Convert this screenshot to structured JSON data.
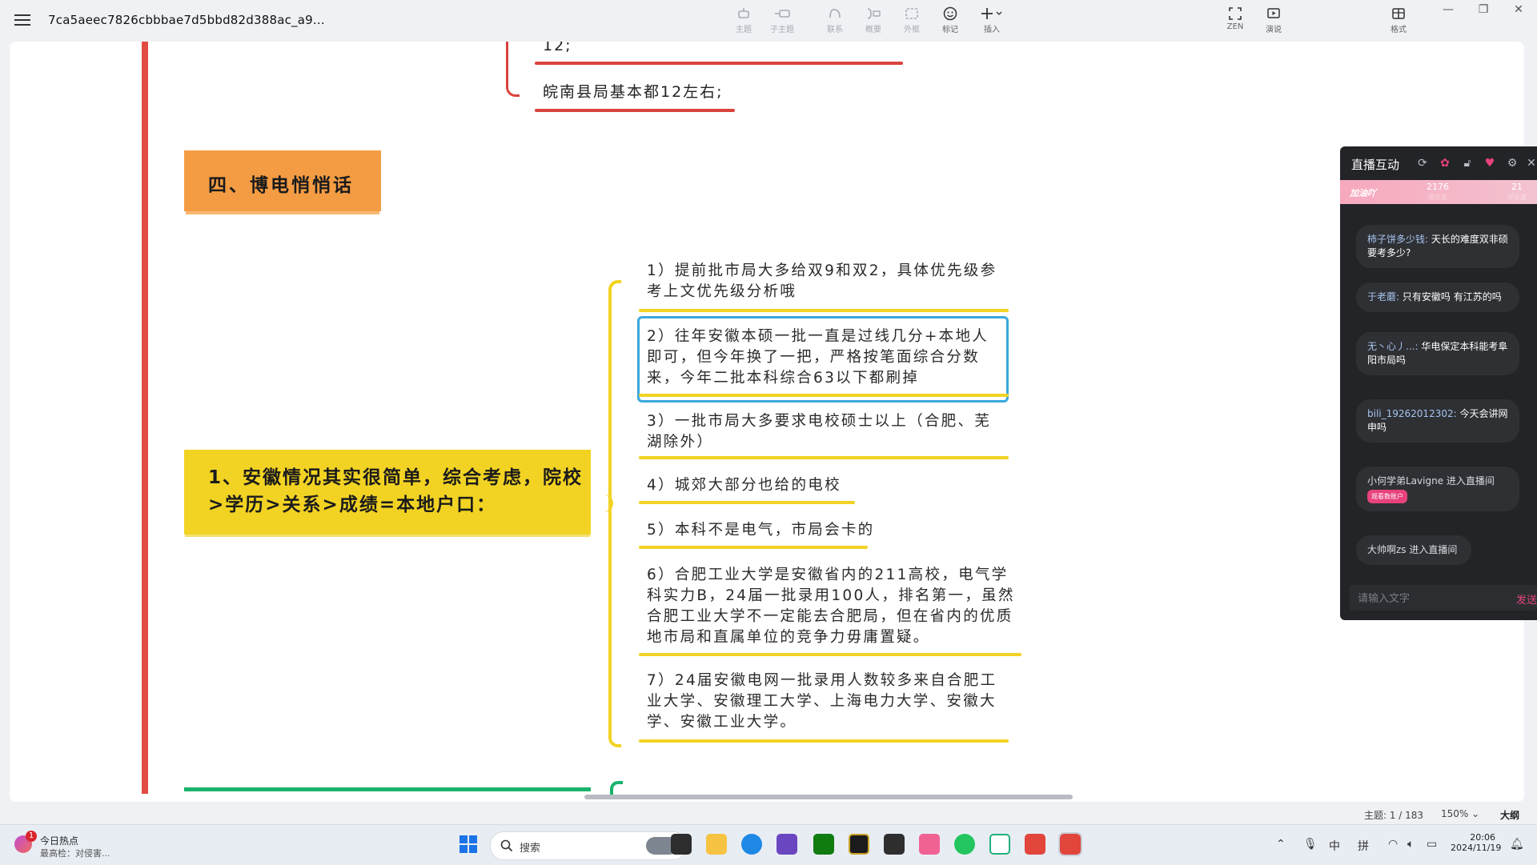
{
  "window": {
    "title": "7ca5aeec7826cbbbae7d5bbd82d388ac_a9...",
    "controls": [
      "—",
      "❐",
      "✕"
    ]
  },
  "toolbar": {
    "items": [
      {
        "label": "主题",
        "icon": "topic-icon",
        "enabled": false
      },
      {
        "label": "子主题",
        "icon": "subtopic-icon",
        "enabled": false
      },
      {
        "label": "联系",
        "icon": "relationship-icon",
        "enabled": false
      },
      {
        "label": "概要",
        "icon": "summary-icon",
        "enabled": false
      },
      {
        "label": "外框",
        "icon": "boundary-icon",
        "enabled": false
      },
      {
        "label": "标记",
        "icon": "marker-icon",
        "enabled": true
      },
      {
        "label": "插入",
        "icon": "insert-icon",
        "enabled": true
      },
      {
        "label": "ZEN",
        "icon": "zen-icon",
        "enabled": true
      },
      {
        "label": "演说",
        "icon": "pitch-icon",
        "enabled": true
      },
      {
        "label": "格式",
        "icon": "format-icon",
        "enabled": true
      }
    ]
  },
  "mindmap": {
    "top_fragment": "12;",
    "top_node": "皖南县局基本都12左右;",
    "section_title": "四、博电悄悄话",
    "main_node": "1、安徽情况其实很简单，综合考虑，院校>学历>关系>成绩=本地户口：",
    "items": [
      "1）提前批市局大多给双9和双2，具体优先级参考上文优先级分析哦",
      "2）往年安徽本硕一批一直是过线几分+本地人即可，但今年换了一把，严格按笔面综合分数来，今年二批本科综合63以下都刷掉",
      "3）一批市局大多要求电校硕士以上（合肥、芜湖除外）",
      "4）城郊大部分也给的电校",
      "5）本科不是电气，市局会卡的",
      "6）合肥工业大学是安徽省内的211高校，电气学科实力B，24届一批录用100人，排名第一，虽然合肥工业大学不一定能去合肥局，但在省内的优质地市局和直属单位的竞争力毋庸置疑。",
      "7）24届安徽电网一批录用人数较多来自合肥工业大学、安徽理工大学、上海电力大学、安徽大学、安徽工业大学。"
    ],
    "colors": {
      "spine": "#e14b42",
      "section": "#f49c43",
      "main": "#f2d323",
      "next": "#19b36b",
      "selection": "#3aa8dd"
    }
  },
  "live_panel": {
    "title": "直播互动",
    "tag": "加油吖",
    "stats": [
      {
        "value": "2176",
        "label": "曝光量"
      },
      {
        "value": "21",
        "label": "评论量"
      }
    ],
    "messages": [
      {
        "user": "柿子饼多少钱:",
        "text": "天长的难度双非硕要考多少?"
      },
      {
        "user": "于老蘑:",
        "text": "只有安徽吗 有江苏的吗"
      },
      {
        "user": "无丶心丿...:",
        "text": "华电保定本科能考阜阳市局吗"
      },
      {
        "user": "bili_19262012302:",
        "text": "今天会讲网申吗"
      },
      {
        "system": "小何学弟Lavigne 进入直播间",
        "badge": "观看数账户"
      },
      {
        "system": "大帅啊zs 进入直播间"
      }
    ],
    "input_placeholder": "请输入文字",
    "send_label": "发送"
  },
  "status_bar": {
    "topic_count": "主题: 1 / 183",
    "zoom": "150%",
    "outline": "大纲"
  },
  "taskbar": {
    "news_badge": "1",
    "news_title": "今日热点",
    "news_sub": "最高检：对侵害...",
    "search_placeholder": "搜索",
    "ime": [
      "中",
      "拼"
    ],
    "time": "20:06",
    "date": "2024/11/19"
  }
}
